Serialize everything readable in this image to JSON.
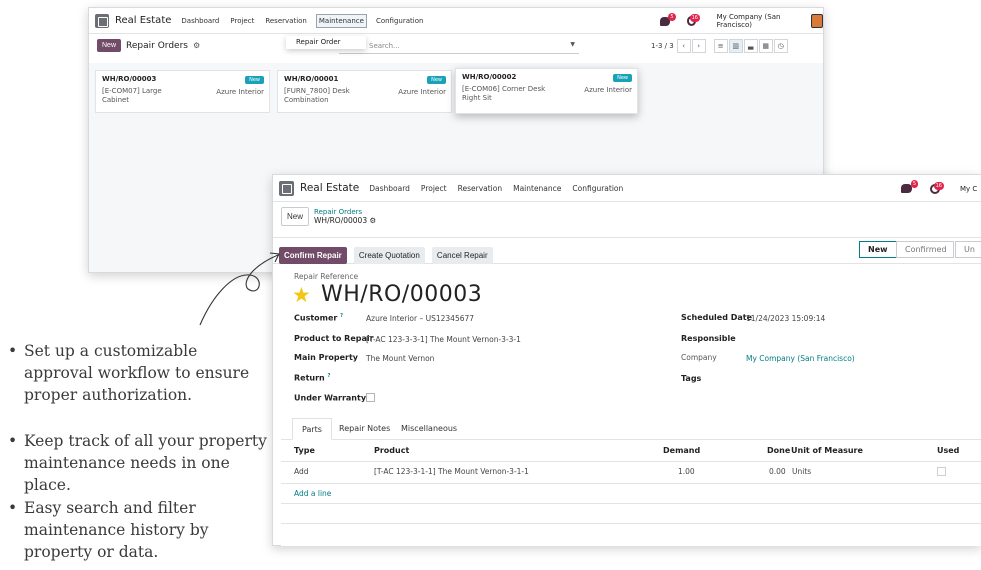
{
  "back": {
    "brand": "Real Estate",
    "menu": [
      "Dashboard",
      "Project",
      "Reservation",
      "Maintenance",
      "Configuration"
    ],
    "company": "My Company (San Francisco)",
    "chat_count": "5",
    "activity_count": "16",
    "new_label": "New",
    "title": "Repair Orders",
    "search_placeholder": "Search...",
    "pager": "1-3 / 3",
    "dropdown_item": "Repair Order",
    "cards": [
      {
        "ref": "WH/RO/00003",
        "tag": "New",
        "customer": "Azure Interior",
        "product": "[E-COM07] Large Cabinet"
      },
      {
        "ref": "WH/RO/00001",
        "tag": "New",
        "customer": "Azure Interior",
        "product": "[FURN_7800] Desk Combination"
      },
      {
        "ref": "WH/RO/00002",
        "tag": "New",
        "customer": "Azure Interior",
        "product": "[E-COM06] Corner Desk Right Sit"
      }
    ]
  },
  "front": {
    "brand": "Real Estate",
    "menu": [
      "Dashboard",
      "Project",
      "Reservation",
      "Maintenance",
      "Configuration"
    ],
    "company_short": "My C",
    "chat_count": "5",
    "activity_count": "16",
    "new_label": "New",
    "breadcrumb_parent": "Repair Orders",
    "breadcrumb_current": "WH/RO/00003",
    "actions": [
      "Confirm Repair",
      "Create Quotation",
      "Cancel Repair"
    ],
    "statuses": [
      "New",
      "Confirmed",
      "Un"
    ],
    "ref_label": "Repair Reference",
    "ref": "WH/RO/00003",
    "fields": {
      "customer_label": "Customer",
      "customer": "Azure Interior – US12345677",
      "product_label": "Product to Repair",
      "product": "[T-AC 123-3-3-1] The Mount Vernon-3-3-1",
      "property_label": "Main Property",
      "property": "The Mount Vernon",
      "return_label": "Return",
      "warranty_label": "Under Warranty",
      "scheduled_label": "Scheduled Date",
      "scheduled": "11/24/2023 15:09:14",
      "responsible_label": "Responsible",
      "company_label": "Company",
      "company": "My Company (San Francisco)",
      "tags_label": "Tags"
    },
    "tabs": [
      "Parts",
      "Repair Notes",
      "Miscellaneous"
    ],
    "columns": [
      "Type",
      "Product",
      "Demand",
      "Done",
      "Unit of Measure",
      "Used"
    ],
    "row": {
      "type": "Add",
      "product": "[T-AC 123-3-1-1] The Mount Vernon-3-1-1",
      "demand": "1.00",
      "done": "0.00",
      "uom": "Units"
    },
    "add_line": "Add a line"
  },
  "bullets": [
    "Set up a customizable approval workflow to ensure proper authorization.",
    "Keep track of all your property maintenance needs in one place.",
    "Easy search and filter maintenance history by property or data."
  ],
  "colors": {
    "brand": "#714b67",
    "teal": "#017e84",
    "badge": "#e0244a"
  }
}
